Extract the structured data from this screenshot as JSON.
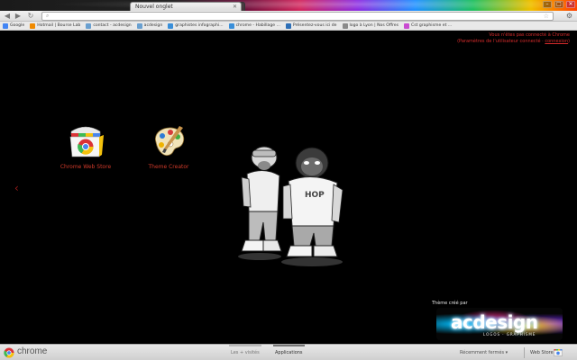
{
  "tabs": [
    {
      "label": "Nouvel onglet",
      "active": true
    },
    {
      "label": "",
      "active": false
    }
  ],
  "bookmarks": [
    {
      "label": "Google",
      "icon": "google-icon",
      "color": "#4285f4"
    },
    {
      "label": "Hotmail | Bourse Lab",
      "icon": "hotmail-icon",
      "color": "#f08a00"
    },
    {
      "label": "contact - acdesign",
      "icon": "page-icon",
      "color": "#6aa0d0"
    },
    {
      "label": "acdesign",
      "icon": "page-icon",
      "color": "#6aa0d0"
    },
    {
      "label": "graphistes infographi...",
      "icon": "page-icon",
      "color": "#3a8fd9"
    },
    {
      "label": "chrome - Habillage ...",
      "icon": "page-icon",
      "color": "#3a8fd9"
    },
    {
      "label": "Présentez-vous ici de",
      "icon": "page-icon",
      "color": "#2d6fb7"
    },
    {
      "label": "logo à Lyon | Nos Offres",
      "icon": "page-icon",
      "color": "#8a8a8a"
    },
    {
      "label": "Cst graphisme et ...",
      "icon": "page-icon",
      "color": "#c94ad1"
    }
  ],
  "sync": {
    "line1": "Vous n'êtes pas connecté à Chrome",
    "line2": "(Paramètres de l'utilisateur connecté · ",
    "link": "connexion",
    "line2_end": ")"
  },
  "apps": [
    {
      "label": "Chrome Web Store"
    },
    {
      "label": "Theme Creator"
    }
  ],
  "credit": {
    "label": "Thème créé par",
    "logo_word": "acdesign",
    "logo_sub": "LOGOS · GRAPHISME"
  },
  "bottom": {
    "brand": "chrome",
    "tabs": [
      {
        "label": "Les + visités"
      },
      {
        "label": "Applications"
      }
    ],
    "recent": "Récemment fermés ▾",
    "webstore": "Web Store"
  },
  "colors": {
    "accent_red": "#d13a2a",
    "background": "#000000"
  }
}
